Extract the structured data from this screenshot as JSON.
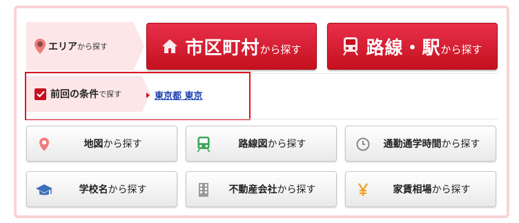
{
  "area": {
    "label_main": "エリア",
    "label_sub": "から探す"
  },
  "big_buttons": [
    {
      "main": "市区町村",
      "sub": "から探す",
      "icon": "house-icon"
    },
    {
      "main": "路線・駅",
      "sub": "から探す",
      "icon": "train-icon"
    }
  ],
  "previous": {
    "label_main": "前回の条件",
    "label_sub": "で探す",
    "link": "東京都 東京"
  },
  "grid_buttons": [
    {
      "main": "地図",
      "sub": "から探す",
      "icon": "map-pin-icon"
    },
    {
      "main": "路線図",
      "sub": "から探す",
      "icon": "train-icon"
    },
    {
      "main": "通勤通学時間",
      "sub": "から探す",
      "icon": "clock-icon"
    },
    {
      "main": "学校名",
      "sub": "から探す",
      "icon": "graduation-cap-icon"
    },
    {
      "main": "不動産会社",
      "sub": "から探す",
      "icon": "building-icon"
    },
    {
      "main": "家賃相場",
      "sub": "から探す",
      "icon": "yen-icon"
    }
  ],
  "colors": {
    "accent_red": "#c5101f",
    "pink_bg": "#fde6e8",
    "panel_border": "#f9d3d5",
    "link_blue": "#1a3fb0"
  }
}
